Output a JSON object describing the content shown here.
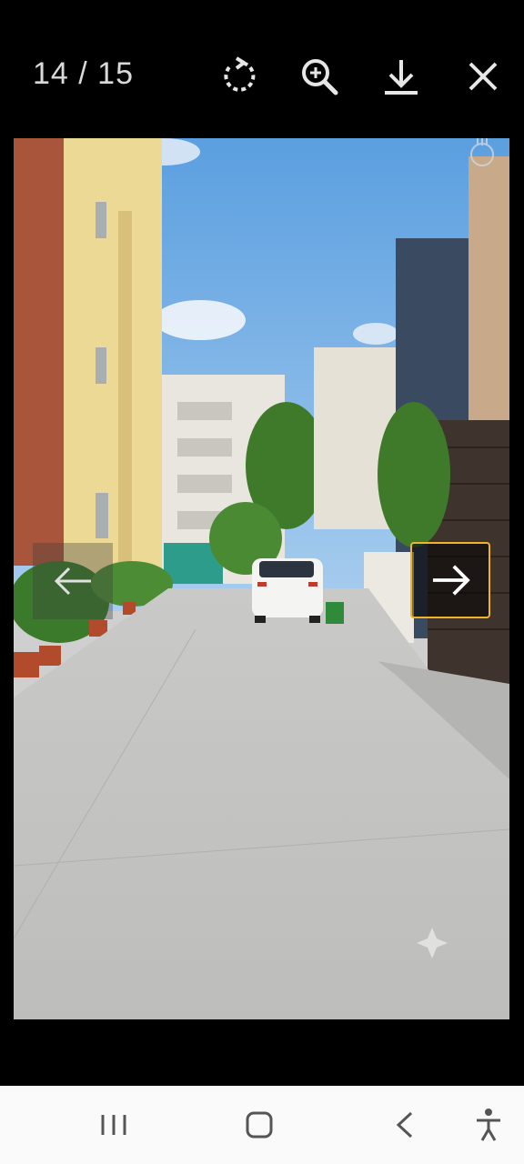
{
  "viewer": {
    "counter": "14 / 15",
    "tools": [
      {
        "icon": "rotate-icon"
      },
      {
        "icon": "zoom-in-icon"
      },
      {
        "icon": "download-icon"
      },
      {
        "icon": "close-icon"
      }
    ]
  },
  "photo": {
    "icon": "street-photo",
    "watermark_icon": "sparkle-icon",
    "corner_icon": "hand-icon"
  },
  "navigation": {
    "prev_icon": "arrow-left-icon",
    "next_icon": "arrow-right-icon",
    "highlight_color": "#f0b429"
  },
  "system_nav": {
    "buttons": [
      "recent-apps-icon",
      "home-icon",
      "back-icon",
      "accessibility-icon"
    ]
  }
}
